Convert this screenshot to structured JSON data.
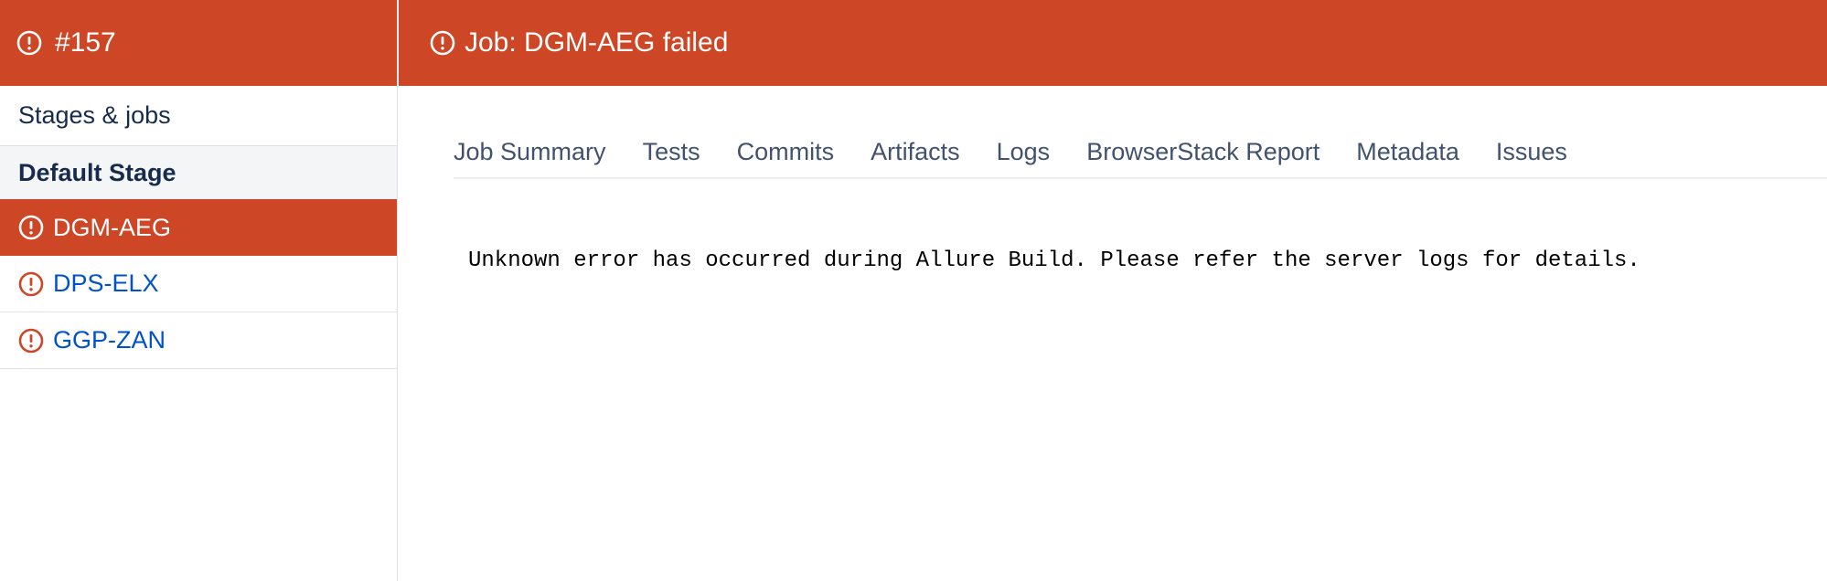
{
  "colors": {
    "accent": "#cd4625",
    "link": "#0052cc",
    "text": "#172b4d",
    "tab_text": "#42526e"
  },
  "sidebar": {
    "build_number": "#157",
    "stages_title": "Stages & jobs",
    "stage_name": "Default Stage",
    "jobs": [
      {
        "label": "DGM-AEG",
        "status": "failed",
        "active": true
      },
      {
        "label": "DPS-ELX",
        "status": "failed",
        "active": false
      },
      {
        "label": "GGP-ZAN",
        "status": "failed",
        "active": false
      }
    ]
  },
  "header": {
    "title": "Job: DGM-AEG failed",
    "icon": "error-icon"
  },
  "tabs": [
    {
      "label": "Job Summary"
    },
    {
      "label": "Tests"
    },
    {
      "label": "Commits"
    },
    {
      "label": "Artifacts"
    },
    {
      "label": "Logs"
    },
    {
      "label": "BrowserStack Report"
    },
    {
      "label": "Metadata"
    },
    {
      "label": "Issues"
    }
  ],
  "content": {
    "message": "Unknown error has occurred during Allure Build. Please refer the server logs for details."
  }
}
